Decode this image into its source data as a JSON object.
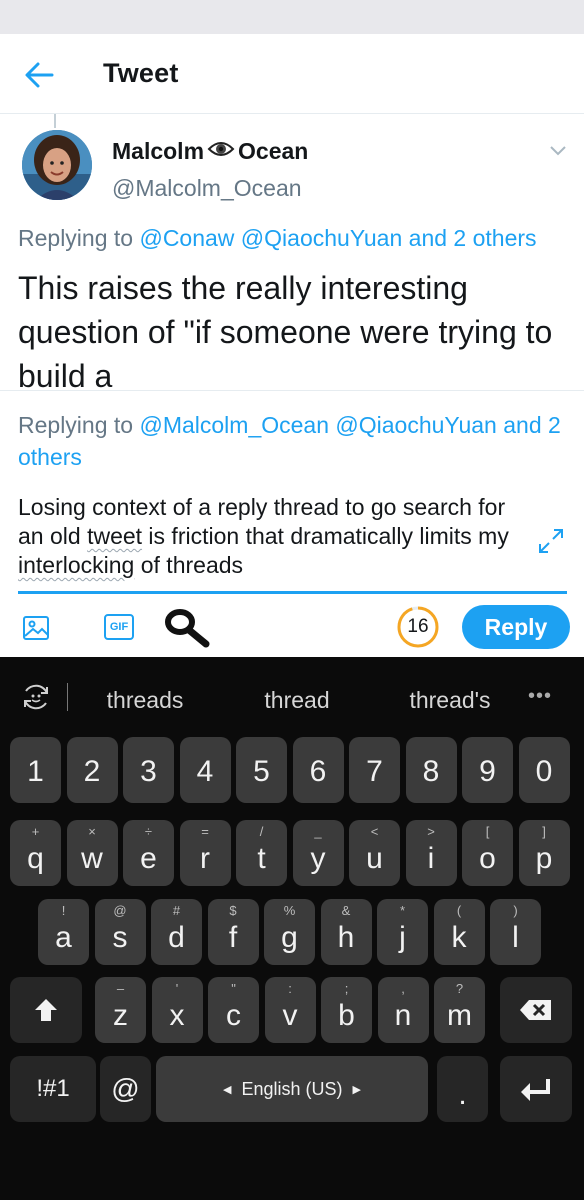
{
  "header": {
    "title": "Tweet"
  },
  "tweet": {
    "author_name_part1": "Malcolm",
    "author_name_part2": "Ocean",
    "author_handle": "@Malcolm_Ocean",
    "replying_prefix": "Replying to",
    "replying_mentions": "@Conaw @QiaochuYuan and 2 others",
    "text": "This raises the really interesting question of \"if someone were trying to build a"
  },
  "compose": {
    "replying_prefix": "Replying to",
    "replying_mentions": "@Malcolm_Ocean @QiaochuYuan and 2 others",
    "text_part1": "Losing context of a reply thread to go search for an old ",
    "text_word1": "tweet",
    "text_part2": " is friction that dramatically limits my ",
    "text_word2": "interlocking",
    "text_part3": " of threads",
    "gif_label": "GIF",
    "char_counter": "16",
    "char_remaining_fraction": 0.95,
    "reply_label": "Reply"
  },
  "keyboard": {
    "suggestions": [
      "threads",
      "thread",
      "thread's"
    ],
    "more": "•••",
    "number_row": [
      "1",
      "2",
      "3",
      "4",
      "5",
      "6",
      "7",
      "8",
      "9",
      "0"
    ],
    "row1": [
      {
        "key": "q",
        "hint": "+"
      },
      {
        "key": "w",
        "hint": "×"
      },
      {
        "key": "e",
        "hint": "÷"
      },
      {
        "key": "r",
        "hint": "="
      },
      {
        "key": "t",
        "hint": "/"
      },
      {
        "key": "y",
        "hint": "_"
      },
      {
        "key": "u",
        "hint": "<"
      },
      {
        "key": "i",
        "hint": ">"
      },
      {
        "key": "o",
        "hint": "["
      },
      {
        "key": "p",
        "hint": "]"
      }
    ],
    "row2": [
      {
        "key": "a",
        "hint": "!"
      },
      {
        "key": "s",
        "hint": "@"
      },
      {
        "key": "d",
        "hint": "#"
      },
      {
        "key": "f",
        "hint": "$"
      },
      {
        "key": "g",
        "hint": "%"
      },
      {
        "key": "h",
        "hint": "&"
      },
      {
        "key": "j",
        "hint": "*"
      },
      {
        "key": "k",
        "hint": "("
      },
      {
        "key": "l",
        "hint": ")"
      }
    ],
    "row3": [
      {
        "key": "z",
        "hint": "–"
      },
      {
        "key": "x",
        "hint": "'"
      },
      {
        "key": "c",
        "hint": "\""
      },
      {
        "key": "v",
        "hint": ":"
      },
      {
        "key": "b",
        "hint": ";"
      },
      {
        "key": "n",
        "hint": ","
      },
      {
        "key": "m",
        "hint": "?"
      }
    ],
    "symbols_label": "!#1",
    "at_label": "@",
    "language_label": "English (US)",
    "period_label": "."
  },
  "colors": {
    "accent": "#1da1f2",
    "counter_ring": "#f5a623"
  }
}
